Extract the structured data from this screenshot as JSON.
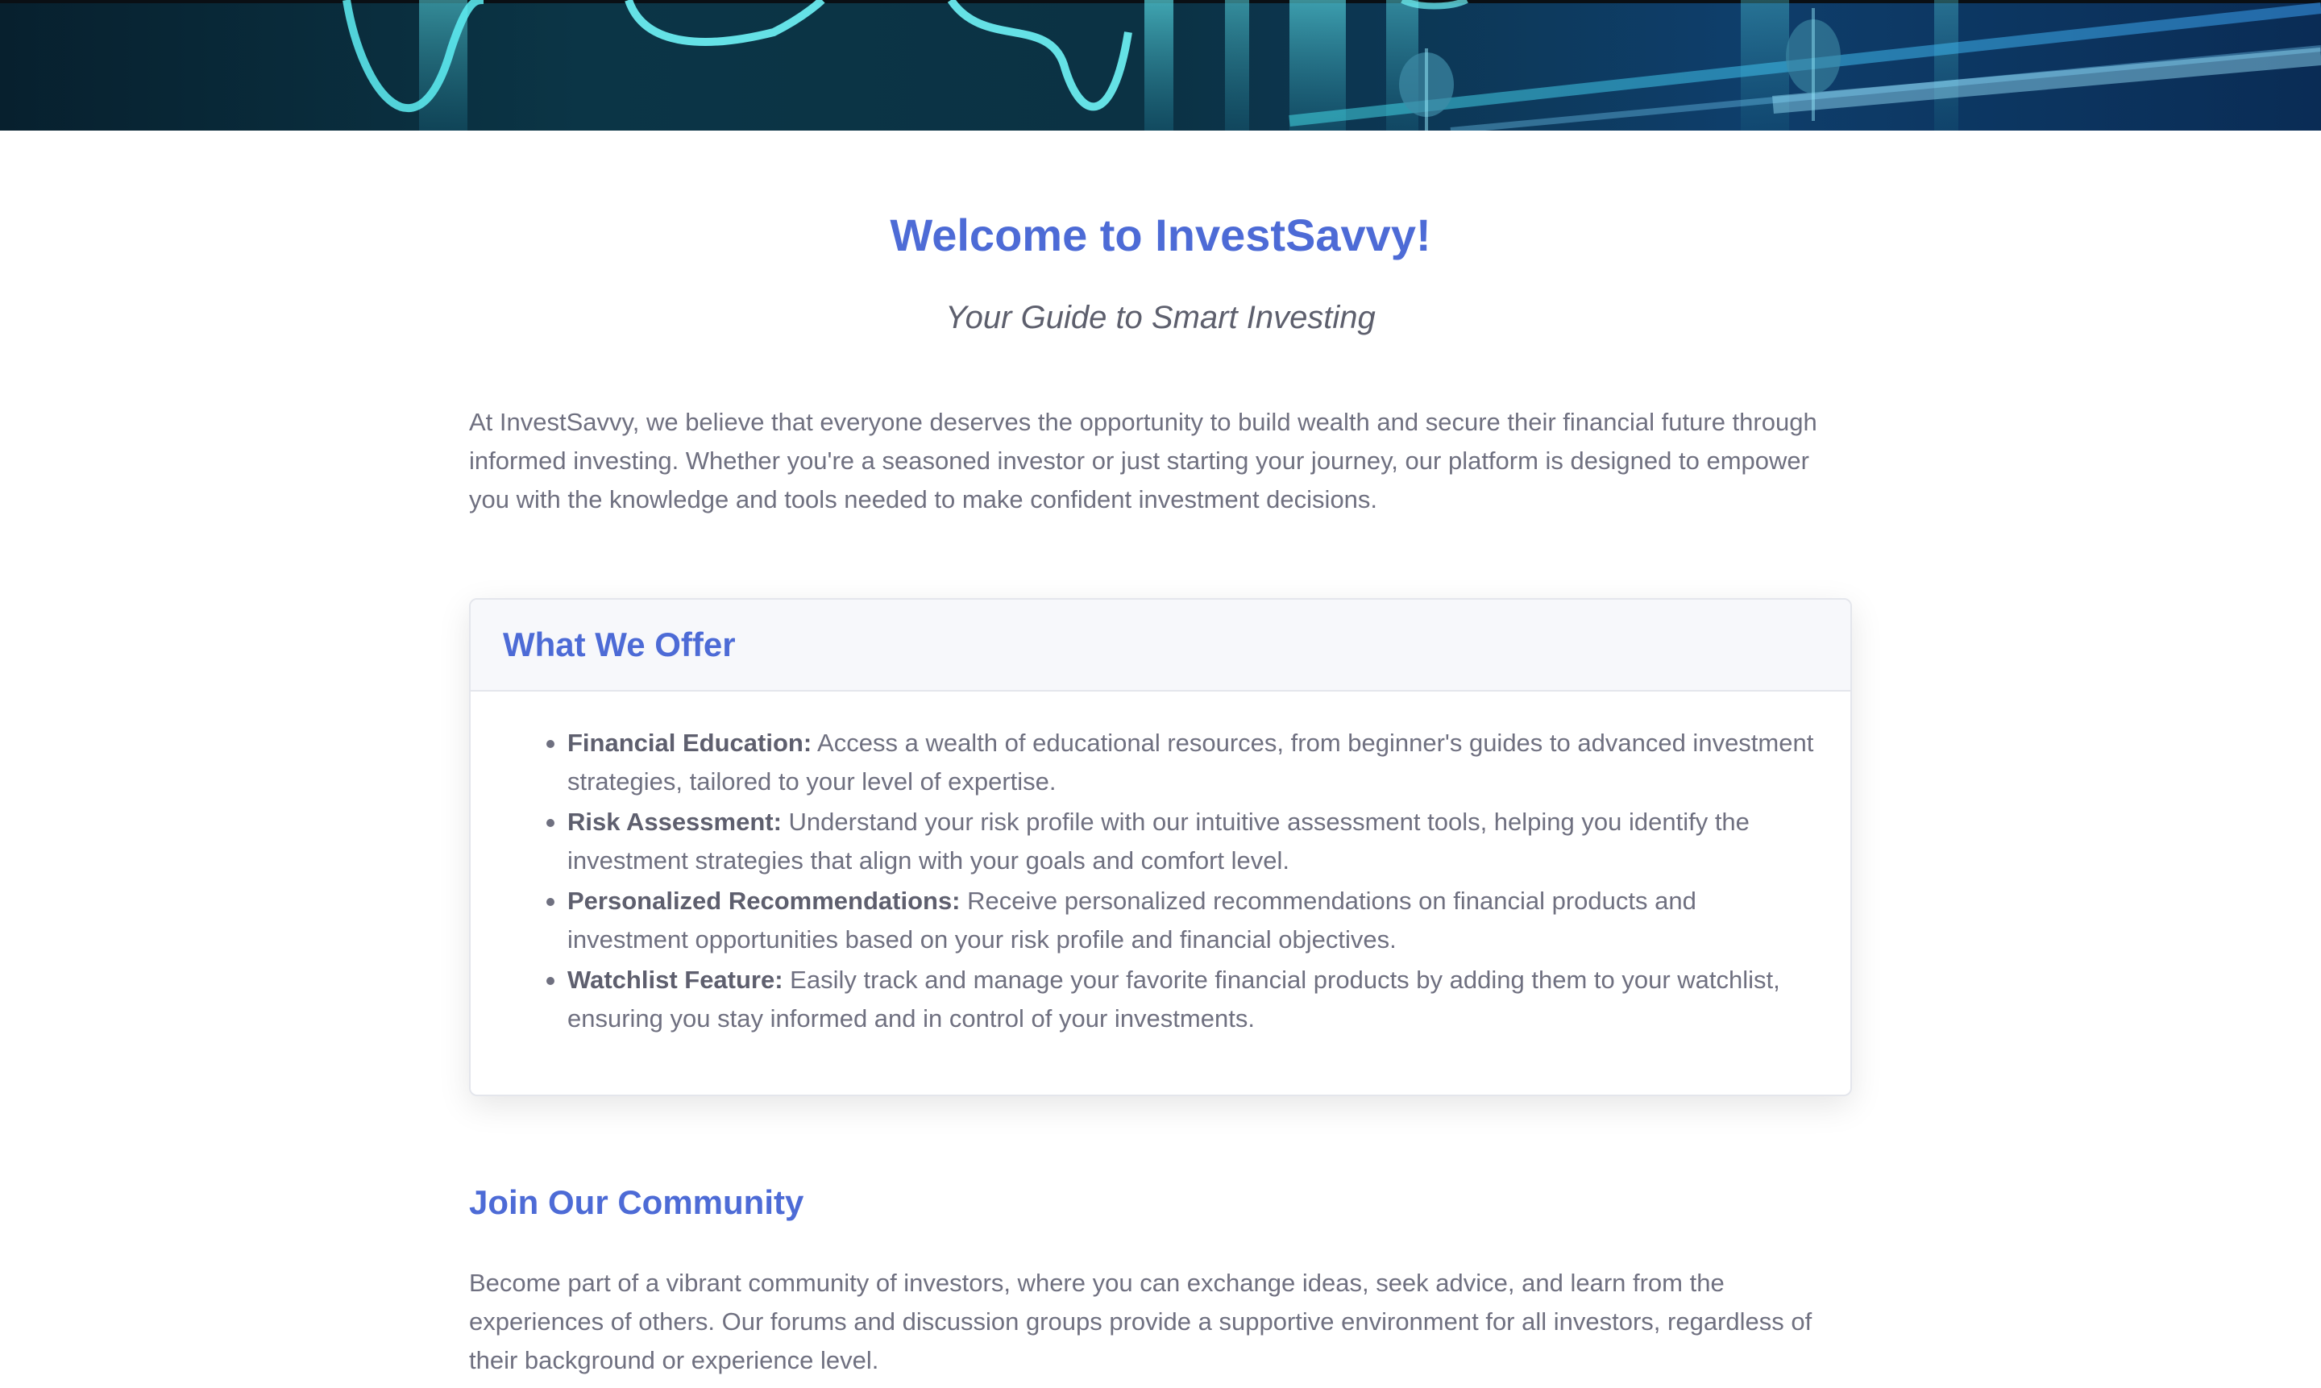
{
  "hero": {
    "image": "stock-chart-banner"
  },
  "header": {
    "title": "Welcome to InvestSavvy!",
    "subtitle": "Your Guide to Smart Investing"
  },
  "intro": "At InvestSavvy, we believe that everyone deserves the opportunity to build wealth and secure their financial future through informed investing. Whether you're a seasoned investor or just starting your journey, our platform is designed to empower you with the knowledge and tools needed to make confident investment decisions.",
  "offer": {
    "title": "What We Offer",
    "items": [
      {
        "term": "Financial Education:",
        "text": " Access a wealth of educational resources, from beginner's guides to advanced investment strategies, tailored to your level of expertise."
      },
      {
        "term": "Risk Assessment:",
        "text": " Understand your risk profile with our intuitive assessment tools, helping you identify the investment strategies that align with your goals and comfort level."
      },
      {
        "term": "Personalized Recommendations:",
        "text": " Receive personalized recommendations on financial products and investment opportunities based on your risk profile and financial objectives."
      },
      {
        "term": "Watchlist Feature:",
        "text": " Easily track and manage your favorite financial products by adding them to your watchlist, ensuring you stay informed and in control of your investments."
      }
    ]
  },
  "community": {
    "title": "Join Our Community",
    "text": "Become part of a vibrant community of investors, where you can exchange ideas, seek advice, and learn from the experiences of others. Our forums and discussion groups provide a supportive environment for all investors, regardless of their background or experience level."
  },
  "colors": {
    "accent": "#4d6bd6",
    "text": "#6f7080",
    "card_header_bg": "#f7f8fb"
  }
}
